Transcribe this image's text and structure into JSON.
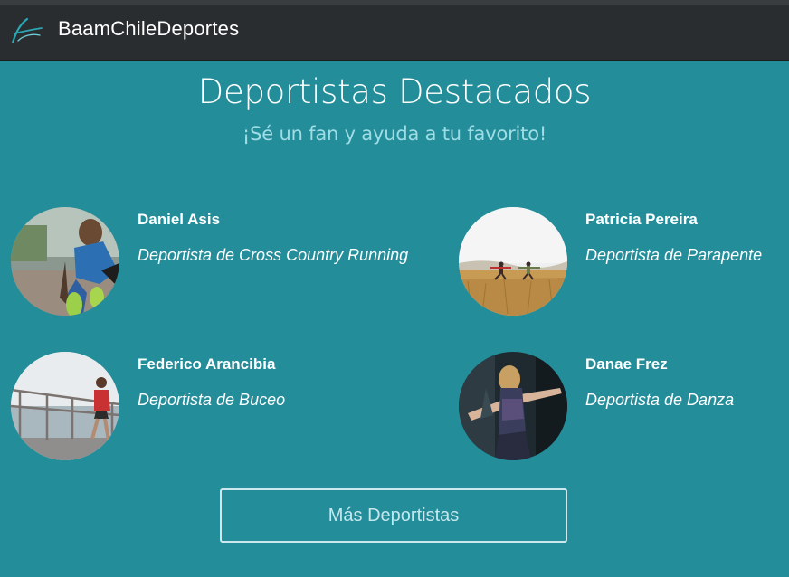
{
  "navbar": {
    "brand": "BaamChileDeportes",
    "logo_icon": "baam-swoosh-logo-icon"
  },
  "hero": {
    "title": "Deportistas Destacados",
    "subtitle": "¡Sé un fan y ayuda a tu favorito!"
  },
  "athletes": [
    {
      "name": "Daniel Asis",
      "sport": "Deportista de Cross Country Running",
      "photo": "runner-stretching-photo"
    },
    {
      "name": "Patricia Pereira",
      "sport": "Deportista de Parapente",
      "photo": "yoga-field-photo"
    },
    {
      "name": "Federico Arancibia",
      "sport": "Deportista de Buceo",
      "photo": "seaside-runner-photo"
    },
    {
      "name": "Danae Frez",
      "sport": "Deportista de Danza",
      "photo": "dancer-photo"
    }
  ],
  "more_button": {
    "label": "Más Deportistas"
  },
  "colors": {
    "background": "#238d9a",
    "navbar": "#2a2d2f",
    "subtitle": "#9fdde5",
    "button_text": "#c4e8ee"
  }
}
